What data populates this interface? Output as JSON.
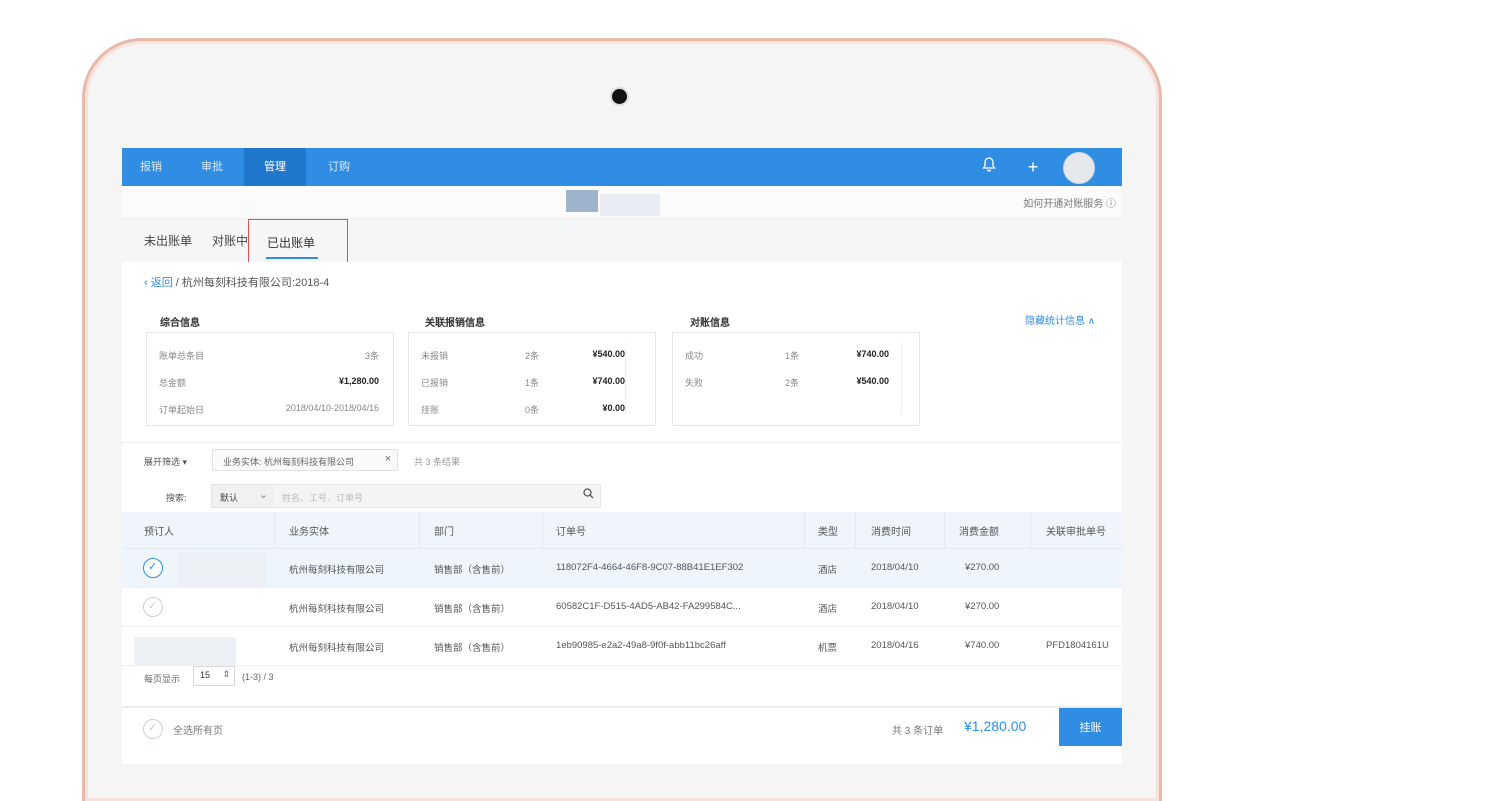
{
  "nav": {
    "tabs": [
      "报销",
      "审批",
      "管理",
      "订购"
    ],
    "active_index": 2,
    "bell_icon": "bell-icon",
    "plus_label": "+"
  },
  "header": {
    "help_link": "如何开通对账服务 ⓘ"
  },
  "subtabs": {
    "unbilled": "未出账单",
    "reconciling": "对账中",
    "billed": "已出账单"
  },
  "breadcrumb": {
    "back": "返回",
    "separator": "/",
    "path": "杭州每刻科技有限公司:2018-4"
  },
  "summary": {
    "title": "综合信息",
    "rows": [
      {
        "label": "账单总条目",
        "value": "3条"
      },
      {
        "label": "总金额",
        "value": "¥1,280.00"
      },
      {
        "label": "订单起始日",
        "value": "2018/04/10-2018/04/16"
      }
    ]
  },
  "related": {
    "title": "关联报销信息",
    "rows": [
      {
        "label": "未报销",
        "count": "2条",
        "amount": "¥540.00"
      },
      {
        "label": "已报销",
        "count": "1条",
        "amount": "¥740.00"
      },
      {
        "label": "挂账",
        "count": "0条",
        "amount": "¥0.00"
      }
    ]
  },
  "reconcile": {
    "title": "对账信息",
    "rows": [
      {
        "label": "成功",
        "count": "1条",
        "amount": "¥740.00"
      },
      {
        "label": "失败",
        "count": "2条",
        "amount": "¥540.00"
      }
    ]
  },
  "toggle_stats": "隐藏统计信息 ∧",
  "filter": {
    "expand_label": "展开筛选 ▾",
    "chip_text": "业务实体: 杭州每刻科技有限公司",
    "chip_close": "×",
    "result_count": "共 3 条结果"
  },
  "search": {
    "label": "搜索:",
    "select_value": "默认",
    "placeholder": "姓名、工号、订单号"
  },
  "table": {
    "columns": [
      "预订人",
      "业务实体",
      "部门",
      "订单号",
      "类型",
      "消费时间",
      "消费金额",
      "关联审批单号"
    ],
    "rows": [
      {
        "entity": "杭州每刻科技有限公司",
        "dept": "销售部（含售前）",
        "order": "118072F4-4664-46F8-9C07-88B41E1EF302",
        "type": "酒店",
        "date": "2018/04/10",
        "amount": "¥270.00",
        "approval": ""
      },
      {
        "entity": "杭州每刻科技有限公司",
        "dept": "销售部（含售前）",
        "order": "60582C1F-D515-4AD5-AB42-FA299584C...",
        "type": "酒店",
        "date": "2018/04/10",
        "amount": "¥270.00",
        "approval": ""
      },
      {
        "entity": "杭州每刻科技有限公司",
        "dept": "销售部（含售前）",
        "order": "1eb90985-e2a2-49a8-9f0f-abb11bc26aff",
        "type": "机票",
        "date": "2018/04/16",
        "amount": "¥740.00",
        "approval": "PFD1804161U"
      }
    ]
  },
  "pager": {
    "per_page_label": "每页显示",
    "per_page": "15",
    "range": "(1-3) / 3"
  },
  "footer": {
    "select_all": "全选所有页",
    "order_total": "共 3 条订单",
    "total_amount": "¥1,280.00",
    "pay_button": "挂账"
  },
  "colors": {
    "primary": "#2f8de4",
    "highlight_border": "#d9534f",
    "device_frame": "#e8b8a8"
  }
}
